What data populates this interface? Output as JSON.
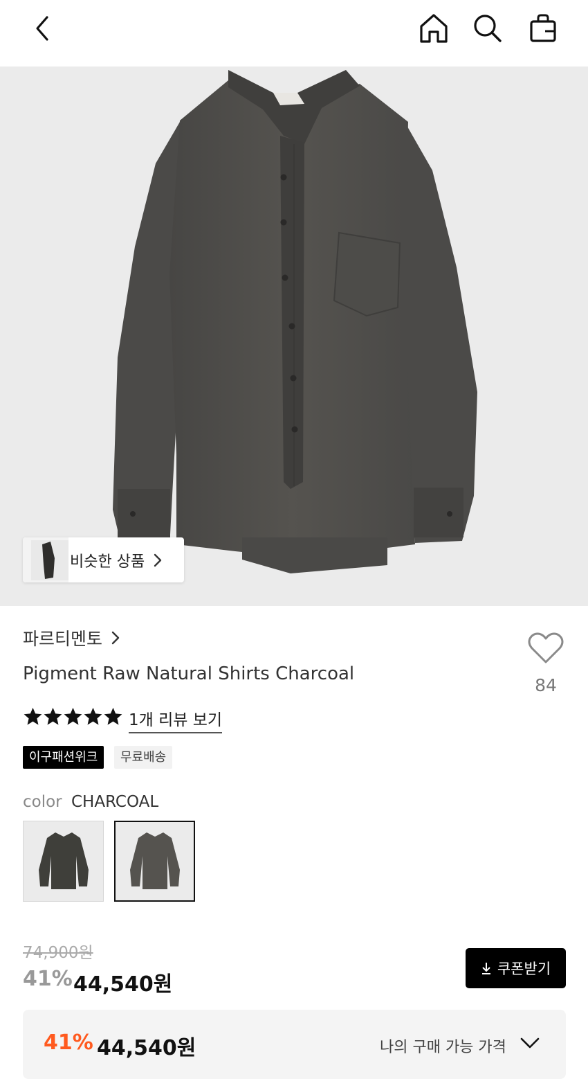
{
  "header": {
    "back_icon": "chevron-left-icon",
    "home_icon": "home-icon",
    "search_icon": "search-icon",
    "bag_icon": "shopping-bag-icon"
  },
  "hero": {
    "similar_label": "비슷한 상품"
  },
  "product": {
    "brand": "파르티멘토",
    "title": "Pigment Raw Natural Shirts Charcoal",
    "like_count": "84",
    "rating_stars": 5,
    "review_link": "1개 리뷰 보기",
    "badges": [
      "이구패션위크",
      "무료배송"
    ],
    "color_label": "color",
    "color_value": "CHARCOAL"
  },
  "price": {
    "original": "74,900원",
    "discount": "41%",
    "sale": "44,540원",
    "coupon_button": "쿠폰받기"
  },
  "my_price": {
    "discount": "41%",
    "price": "44,540원",
    "label": "나의 구매 가능 가격"
  },
  "colors": {
    "accent_orange": "#ff5a1f",
    "shirt": "#4e4d4b"
  }
}
